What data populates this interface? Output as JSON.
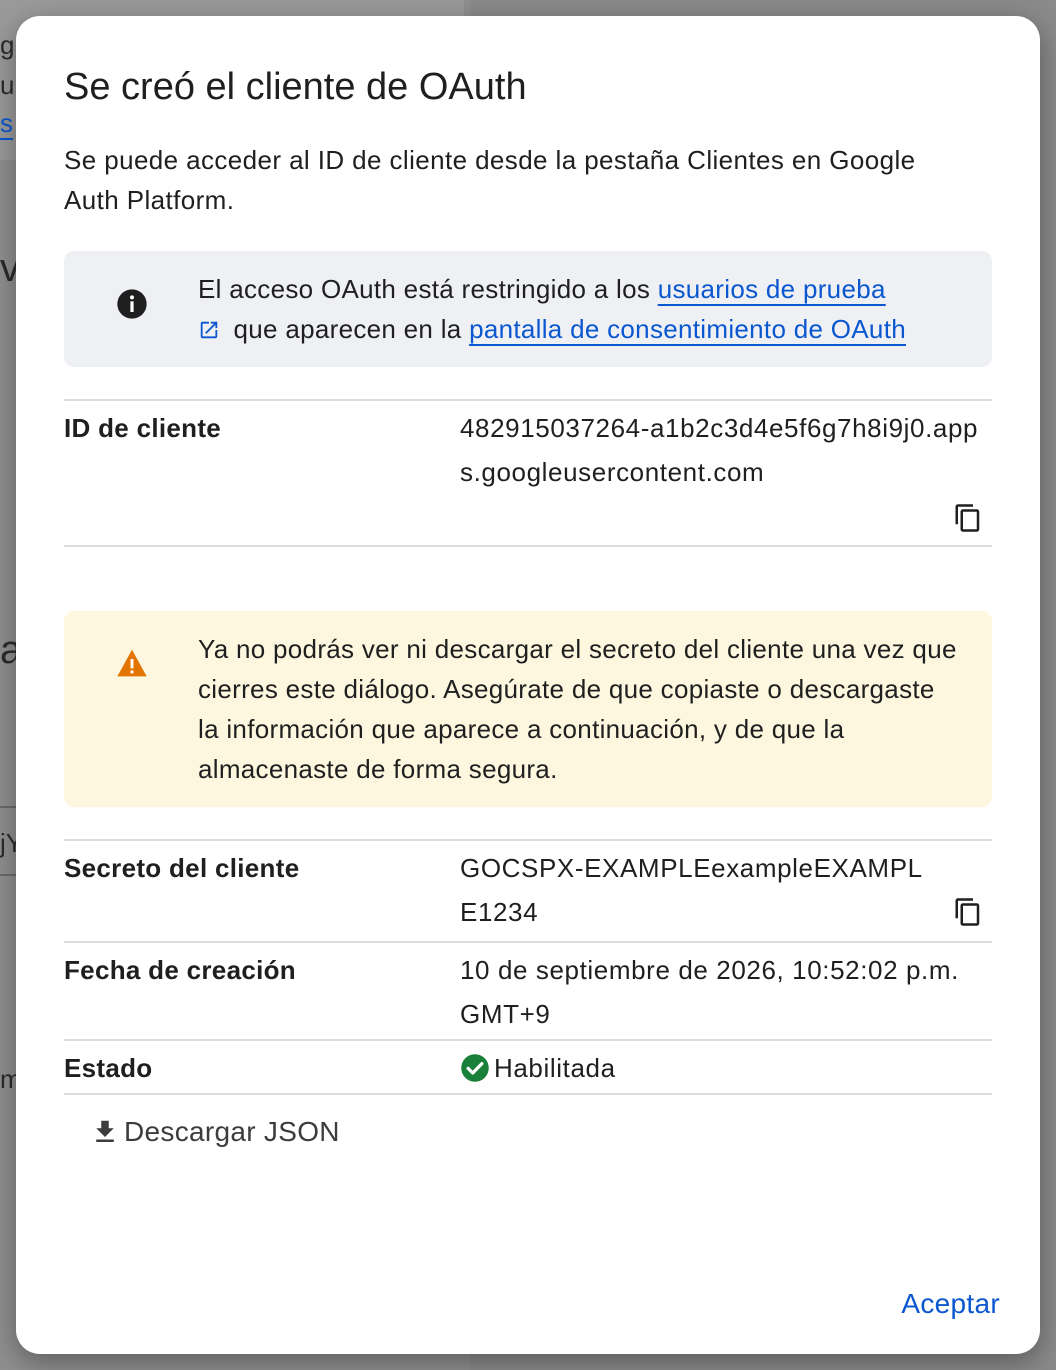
{
  "background": {
    "fragments": [
      "gu",
      "u",
      "s",
      "va",
      "a",
      "jY",
      "mi"
    ]
  },
  "dialog": {
    "title": "Se creó el cliente de OAuth",
    "subtitle": "Se puede acceder al ID de cliente desde la pestaña Clientes en Google Auth Platform.",
    "info_banner": {
      "text_before": "El acceso OAuth está restringido a los ",
      "link1": "usuarios de prueba",
      "text_middle": " que aparecen en la ",
      "link2": "pantalla de consentimiento de OAuth",
      "icon": "info-icon"
    },
    "client_id": {
      "label": "ID de cliente",
      "value": "482915037264-a1b2c3d4e5f6g7h8i9j0.apps.googleusercontent.com"
    },
    "warning_banner": {
      "text": "Ya no podrás ver ni descargar el secreto del cliente una vez que cierres este diálogo. Asegúrate de que copiaste o descargaste la información que aparece a continuación, y de que la almacenaste de forma segura.",
      "icon": "warning-icon"
    },
    "client_secret": {
      "label": "Secreto del cliente",
      "value": "GOCSPX-EXAMPLEexampleEXAMPLE1234"
    },
    "creation_date": {
      "label": "Fecha de creación",
      "value": "10 de septiembre de 2026, 10:52:02 p.m. GMT+9"
    },
    "status": {
      "label": "Estado",
      "value": "Habilitada",
      "icon": "check-circle-icon"
    },
    "download_label": "Descargar JSON",
    "accept_label": "Aceptar"
  },
  "colors": {
    "accent": "#0b57d0",
    "info_bg": "#eef0f4",
    "warning_bg": "#fef7e0",
    "warning_icon": "#e37400",
    "success": "#188038"
  }
}
